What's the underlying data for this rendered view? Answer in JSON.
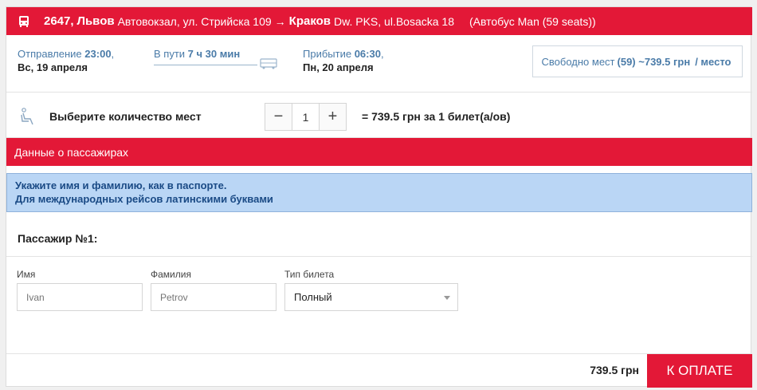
{
  "header": {
    "route_number": "2647,",
    "from_city": "Львов",
    "from_address": "Автовокзал, ул. Стрийска 109",
    "arrow": "→",
    "to_city": "Краков",
    "to_address": "Dw. PKS, ul.Bosacka 18",
    "bus_model": "(Автобус Man (59 seats))",
    "icon": "bus-icon"
  },
  "trip": {
    "departure_label": "Отправление",
    "departure_time": "23:00",
    "departure_suffix": ",",
    "departure_date": "Вс, 19 апреля",
    "duration_label": "В пути",
    "duration_value": "7 ч 30 мин",
    "arrival_label": "Прибытие",
    "arrival_time": "06:30",
    "arrival_suffix": ",",
    "arrival_date": "Пн, 20 апреля",
    "seats_label": "Свободно мест",
    "seats_value": "(59) ~739.5 грн",
    "seats_suffix": "/ место"
  },
  "seats": {
    "label": "Выберите количество мест",
    "minus": "−",
    "quantity": "1",
    "plus": "+",
    "price_text": "= 739.5 грн за 1 билет(а/ов)",
    "icon": "seat-icon"
  },
  "passengers": {
    "section_title": "Данные о пассажирах",
    "notice_line1": "Укажите имя и фамилию, как в паспорте.",
    "notice_line2": "Для международных рейсов латинскими буквами",
    "passenger_title": "Пассажир №1:",
    "name_label": "Имя",
    "name_placeholder": "Ivan",
    "surname_label": "Фамилия",
    "surname_placeholder": "Petrov",
    "ticket_type_label": "Тип билета",
    "ticket_type_value": "Полный"
  },
  "footer": {
    "total": "739.5 грн",
    "pay_button": "К ОПЛАТЕ"
  },
  "colors": {
    "accent": "#e31837",
    "link_blue": "#4a7ba8",
    "notice_bg": "#bad6f5"
  }
}
